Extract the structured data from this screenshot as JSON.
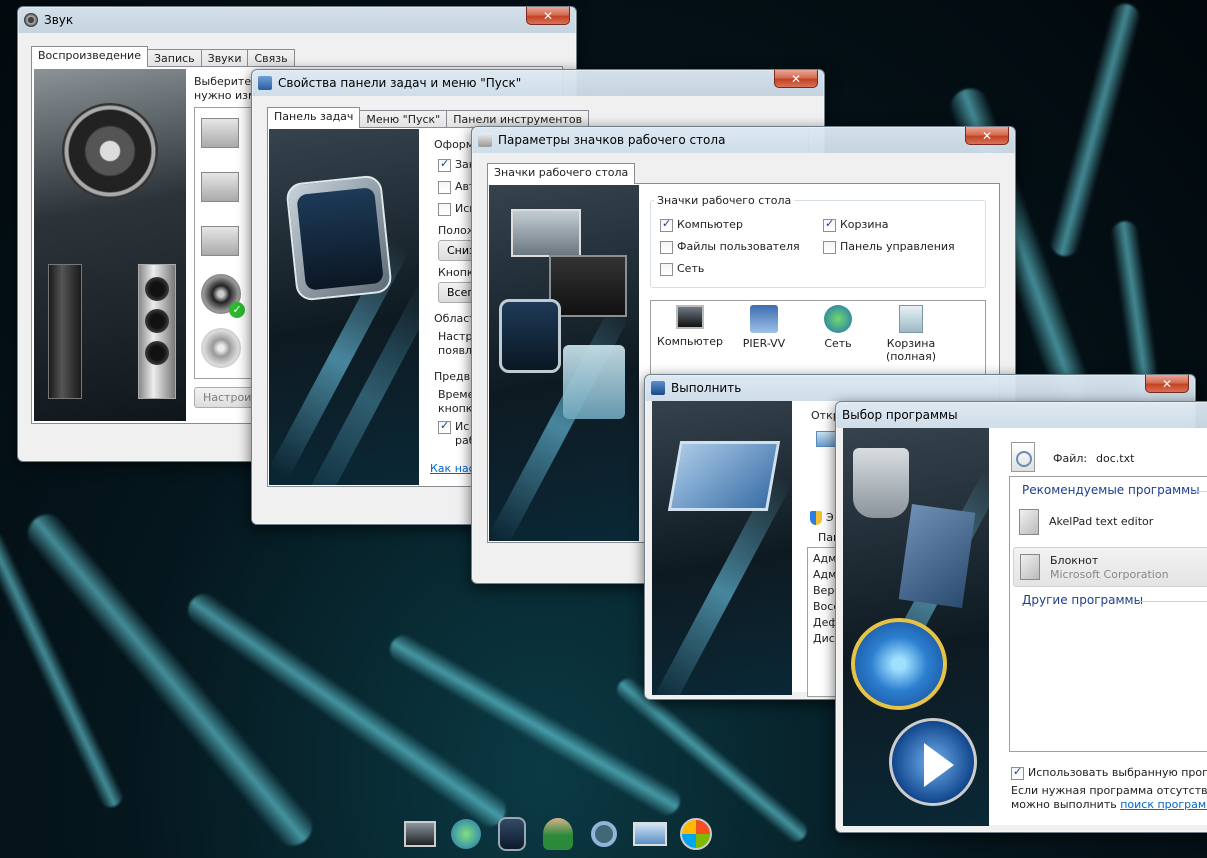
{
  "sound_window": {
    "title": "Звук",
    "tabs": [
      "Воспроизведение",
      "Запись",
      "Звуки",
      "Связь"
    ],
    "description_line1": "Выберите",
    "description_line2": "нужно изм",
    "configure_button": "Настроит"
  },
  "taskbar_window": {
    "title": "Свойства панели задач и меню \"Пуск\"",
    "tabs": [
      "Панель задач",
      "Меню \"Пуск\"",
      "Панели инструментов"
    ],
    "group_appearance": "Оформ",
    "check_items": [
      {
        "label": "Зак",
        "checked": true
      },
      {
        "label": "Авт",
        "checked": false
      },
      {
        "label": "Исп",
        "checked": false
      }
    ],
    "position_label": "Полож",
    "position_value": "Снизу",
    "buttons_label": "Кнопк",
    "buttons_value": "Всегд",
    "notify_area": "Област",
    "notify_text1": "Настро",
    "notify_text2": "появл",
    "preview_label": "Предв",
    "preview_text1": "Времен",
    "preview_text2": "кнопку",
    "preview_check1": "Ис",
    "preview_check2": "раб",
    "link": "Как наст"
  },
  "icons_window": {
    "title": "Параметры значков рабочего стола",
    "tab": "Значки рабочего стола",
    "group_label": "Значки рабочего стола",
    "checks": [
      {
        "label": "Компьютер",
        "checked": true
      },
      {
        "label": "Корзина",
        "checked": true
      },
      {
        "label": "Файлы пользователя",
        "checked": false
      },
      {
        "label": "Панель управления",
        "checked": false
      },
      {
        "label": "Сеть",
        "checked": false
      }
    ],
    "preview_icons": [
      {
        "label": "Компьютер",
        "icon": "computer-icon"
      },
      {
        "label": "PIER-VV",
        "icon": "user-folder-icon"
      },
      {
        "label": "Сеть",
        "icon": "network-icon"
      },
      {
        "label": "Корзина",
        "label2": "(полная)",
        "icon": "recycle-bin-icon"
      }
    ]
  },
  "run_window": {
    "title": "Выполнить",
    "open_label": "Откр",
    "side_label1": "Э",
    "side_label2": "Пам",
    "list_items": [
      "Адми",
      "Адми",
      "Верс",
      "Восст",
      "Дефр",
      "Дисп"
    ]
  },
  "openwith_window": {
    "title": "Выбор программы",
    "file_label": "Файл:",
    "file_name": "doc.txt",
    "recommended_header": "Рекомендуемые программы",
    "programs": [
      {
        "name": "AkelPad text editor",
        "publisher": ""
      },
      {
        "name": "Блокнот",
        "publisher": "Microsoft Corporation"
      }
    ],
    "other_header": "Другие программы",
    "always_use": "Использовать выбранную программу",
    "footer_line1": "Если нужная программа отсутствует на",
    "footer_line2": "можно выполнить",
    "footer_link": "поиск программы в И"
  },
  "dock": [
    "monitor-icon",
    "globe-network-icon",
    "gadget-icon",
    "users-icon",
    "magnifier-icon",
    "window-icon",
    "windows-logo-icon"
  ]
}
